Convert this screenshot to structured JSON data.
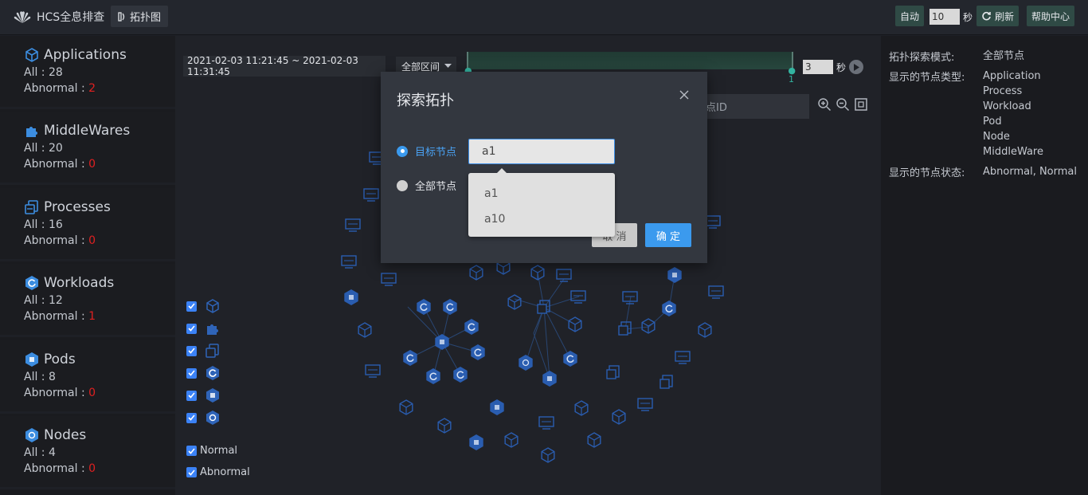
{
  "header": {
    "app_title": "HCS全息排查",
    "tab_label": "拓扑图",
    "auto_label": "自动",
    "refresh_interval": "10",
    "seconds_label": "秒",
    "refresh_label": "刷新",
    "help_label": "帮助中心"
  },
  "sidebar": {
    "cards": [
      {
        "title": "Applications",
        "all": "All : 28",
        "abnormal_label": "Abnormal : ",
        "abnormal": "2",
        "icon": "cube-icon"
      },
      {
        "title": "MiddleWares",
        "all": "All : 20",
        "abnormal_label": "Abnormal : ",
        "abnormal": "0",
        "icon": "puzzle-icon"
      },
      {
        "title": "Processes",
        "all": "All : 16",
        "abnormal_label": "Abnormal : ",
        "abnormal": "0",
        "icon": "process-icon"
      },
      {
        "title": "Workloads",
        "all": "All : 12",
        "abnormal_label": "Abnormal : ",
        "abnormal": "1",
        "icon": "workload-icon"
      },
      {
        "title": "Pods",
        "all": "All : 8",
        "abnormal_label": "Abnormal : ",
        "abnormal": "0",
        "icon": "pod-icon"
      },
      {
        "title": "Nodes",
        "all": "All : 4",
        "abnormal_label": "Abnormal : ",
        "abnormal": "0",
        "icon": "node-icon"
      }
    ]
  },
  "main": {
    "time_range": "2021-02-03 11:21:45 ~ 2021-02-03 11:31:45",
    "area_select": "全部区间",
    "timeline_end_label": "1",
    "play_interval": "3",
    "seconds_label": "秒",
    "search_placeholder": "点ID",
    "status_filters": [
      "Normal",
      "Abnormal"
    ]
  },
  "right_panel": {
    "mode_key": "拓扑探索模式:",
    "mode_value": "全部节点",
    "types_key": "显示的节点类型:",
    "types": [
      "Application",
      "Process",
      "Workload",
      "Pod",
      "Node",
      "MiddleWare"
    ],
    "status_key": "显示的节点状态:",
    "status_value": "Abnormal, Normal"
  },
  "modal": {
    "title": "探索拓扑",
    "option_target": "目标节点",
    "option_all": "全部节点",
    "input_value": "a1",
    "suggestions": [
      "a1",
      "a10"
    ],
    "cancel_label": "取 消",
    "ok_label": "确 定"
  },
  "colors": {
    "accent": "#3b9aee",
    "abnormal": "#e02020",
    "node_blue": "#2a5db0"
  }
}
